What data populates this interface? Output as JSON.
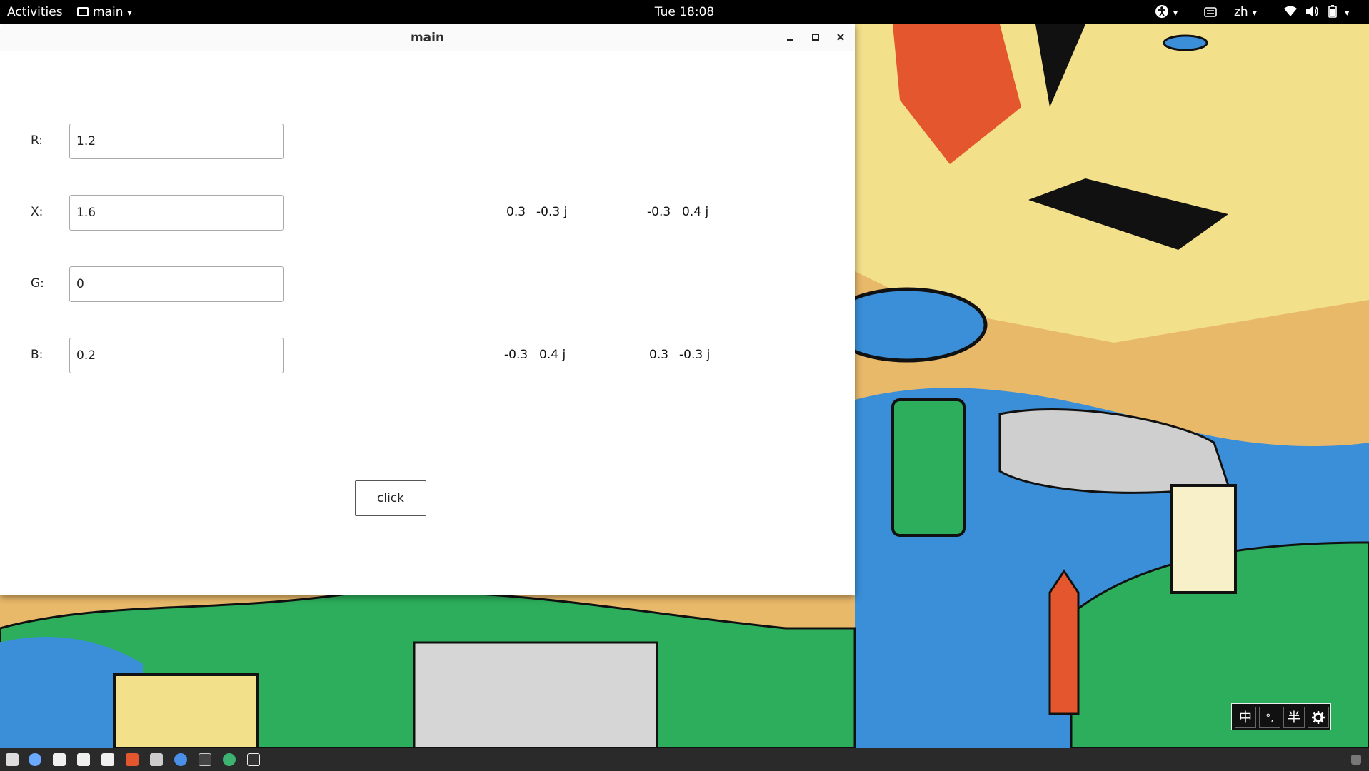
{
  "topbar": {
    "activities": "Activities",
    "app_menu": "main",
    "clock": "Tue 18:08",
    "language": "zh"
  },
  "window": {
    "title": "main",
    "fields": [
      {
        "label": "R:",
        "value": "1.2"
      },
      {
        "label": "X:",
        "value": "1.6"
      },
      {
        "label": "G:",
        "value": "0"
      },
      {
        "label": "B:",
        "value": "0.2"
      }
    ],
    "results": {
      "row1": {
        "c1_re": "0.3",
        "c1_im": "-0.3 j",
        "c2_re": "-0.3",
        "c2_im": "0.4 j"
      },
      "row2": {
        "c1_re": "-0.3",
        "c1_im": "0.4 j",
        "c2_re": "0.3",
        "c2_im": "-0.3 j"
      }
    },
    "button_label": "click"
  },
  "ime": {
    "mode": "中",
    "punct": "°,",
    "width": "半"
  }
}
